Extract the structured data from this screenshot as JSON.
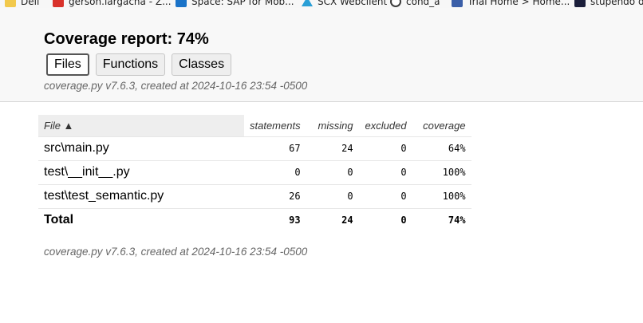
{
  "bookmarks": [
    {
      "label": "Dell",
      "icon": "folder-icon"
    },
    {
      "label": "gerson.largacha - Z...",
      "icon": "z-app-icon"
    },
    {
      "label": "Space: SAP for Mob...",
      "icon": "sap-icon"
    },
    {
      "label": "SCX Webclient",
      "icon": "scx-icon"
    },
    {
      "label": "cond_a",
      "icon": "wordpress-icon"
    },
    {
      "label": "Trial Home > Home...",
      "icon": "trial-icon"
    },
    {
      "label": "stupendo di",
      "icon": "l-app-icon"
    }
  ],
  "header": {
    "title": "Coverage report: 74%",
    "tabs": [
      {
        "label": "Files",
        "active": true
      },
      {
        "label": "Functions",
        "active": false
      },
      {
        "label": "Classes",
        "active": false
      }
    ],
    "created": "coverage.py v7.6.3, created at 2024-10-16 23:54 -0500"
  },
  "table": {
    "headers": {
      "file": "File ▲",
      "statements": "statements",
      "missing": "missing",
      "excluded": "excluded",
      "coverage": "coverage"
    },
    "rows": [
      {
        "file": "src\\main.py",
        "statements": "67",
        "missing": "24",
        "excluded": "0",
        "coverage": "64%"
      },
      {
        "file": "test\\__init__.py",
        "statements": "0",
        "missing": "0",
        "excluded": "0",
        "coverage": "100%"
      },
      {
        "file": "test\\test_semantic.py",
        "statements": "26",
        "missing": "0",
        "excluded": "0",
        "coverage": "100%"
      }
    ],
    "total": {
      "file": "Total",
      "statements": "93",
      "missing": "24",
      "excluded": "0",
      "coverage": "74%"
    }
  },
  "footer": {
    "created": "coverage.py v7.6.3, created at 2024-10-16 23:54 -0500"
  }
}
